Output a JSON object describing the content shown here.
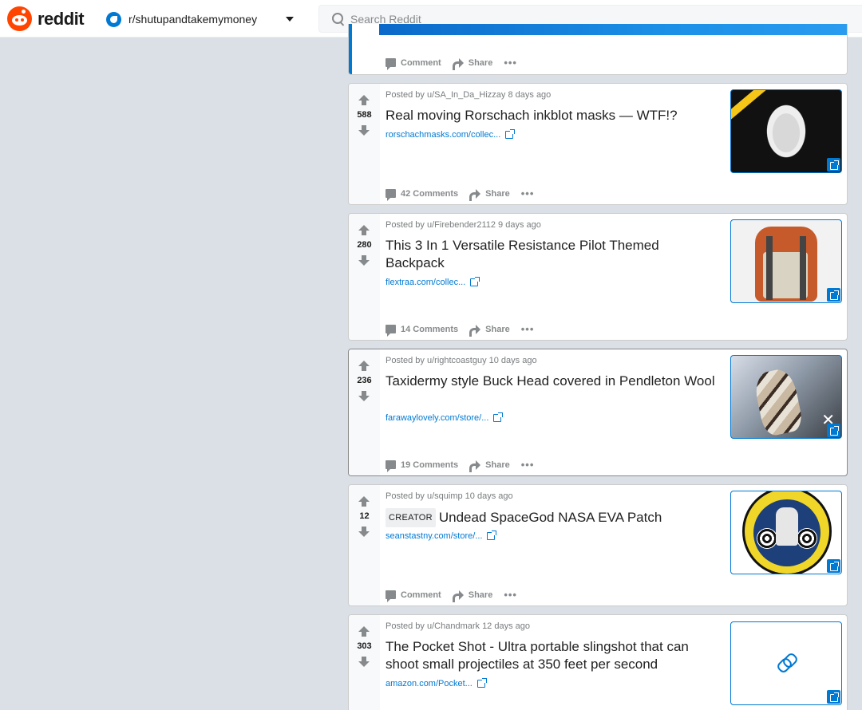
{
  "header": {
    "logo_text": "reddit",
    "subreddit": "r/shutupandtakemymoney",
    "search_placeholder": "Search Reddit"
  },
  "partial_post": {
    "actions": {
      "comments": "Comment",
      "share": "Share",
      "more": "•••"
    }
  },
  "posts": [
    {
      "score": "588",
      "meta": "Posted by u/SA_In_Da_Hizzay 8 days ago",
      "title": "Real moving Rorschach inkblot masks — WTF!?",
      "link": "rorschachmasks.com/collec...",
      "comments": "42 Comments",
      "share": "Share",
      "more": "•••"
    },
    {
      "score": "280",
      "meta": "Posted by u/Firebender2112 9 days ago",
      "title": "This 3 In 1 Versatile Resistance Pilot Themed Backpack",
      "link": "flextraa.com/collec...",
      "comments": "14 Comments",
      "share": "Share",
      "more": "•••"
    },
    {
      "score": "236",
      "meta": "Posted by u/rightcoastguy 10 days ago",
      "title": "Taxidermy style Buck Head covered in Pendleton Wool",
      "link": "farawaylovely.com/store/...",
      "comments": "19 Comments",
      "share": "Share",
      "more": "•••"
    },
    {
      "score": "12",
      "meta": "Posted by u/squimp 10 days ago",
      "flair": "CREATOR",
      "title": "Undead SpaceGod NASA EVA Patch",
      "link": "seanstastny.com/store/...",
      "comments": "Comment",
      "share": "Share",
      "more": "•••"
    },
    {
      "score": "303",
      "meta": "Posted by u/Chandmark 12 days ago",
      "title": "The Pocket Shot - Ultra portable slingshot that can shoot small projectiles at 350 feet per second",
      "link": "amazon.com/Pocket...",
      "comments": "",
      "share": "",
      "more": ""
    }
  ],
  "colors": {
    "accent": "#0079d3",
    "brand": "#ff4500",
    "background": "#dae0e6"
  }
}
